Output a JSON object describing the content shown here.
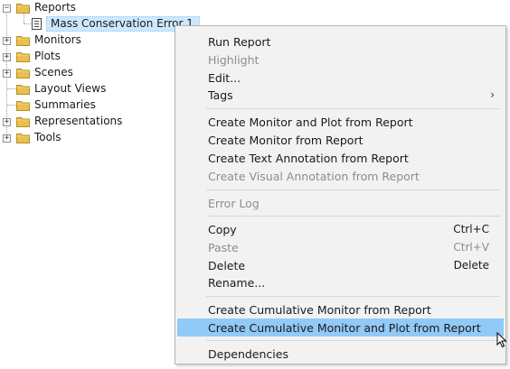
{
  "tree": {
    "items": [
      {
        "label": "Reports",
        "expander": "−"
      },
      {
        "label": "Mass Conservation Error 1"
      },
      {
        "label": "Monitors",
        "expander": "+"
      },
      {
        "label": "Plots",
        "expander": "+"
      },
      {
        "label": "Scenes",
        "expander": "+"
      },
      {
        "label": "Layout Views"
      },
      {
        "label": "Summaries"
      },
      {
        "label": "Representations",
        "expander": "+"
      },
      {
        "label": "Tools",
        "expander": "+"
      }
    ]
  },
  "menu": {
    "items": [
      {
        "label": "Run Report",
        "enabled": true
      },
      {
        "label": "Highlight",
        "enabled": false
      },
      {
        "label": "Edit...",
        "enabled": true
      },
      {
        "label": "Tags",
        "enabled": true,
        "submenu": "›"
      },
      {
        "label": "Create Monitor and Plot from Report",
        "enabled": true
      },
      {
        "label": "Create Monitor from Report",
        "enabled": true
      },
      {
        "label": "Create Text Annotation from Report",
        "enabled": true
      },
      {
        "label": "Create Visual Annotation from Report",
        "enabled": false
      },
      {
        "label": "Error Log",
        "enabled": false
      },
      {
        "label": "Copy",
        "shortcut": "Ctrl+C",
        "enabled": true
      },
      {
        "label": "Paste",
        "shortcut": "Ctrl+V",
        "enabled": false
      },
      {
        "label": "Delete",
        "shortcut": "Delete",
        "enabled": true
      },
      {
        "label": "Rename...",
        "enabled": true
      },
      {
        "label": "Create Cumulative Monitor from Report",
        "enabled": true
      },
      {
        "label": "Create Cumulative Monitor and Plot from Report",
        "enabled": true,
        "highlighted": true
      },
      {
        "label": "Dependencies",
        "enabled": true
      }
    ]
  },
  "colors": {
    "folder": "#e8c04e",
    "highlight": "#91c9f7",
    "selection": "#cce8ff"
  }
}
